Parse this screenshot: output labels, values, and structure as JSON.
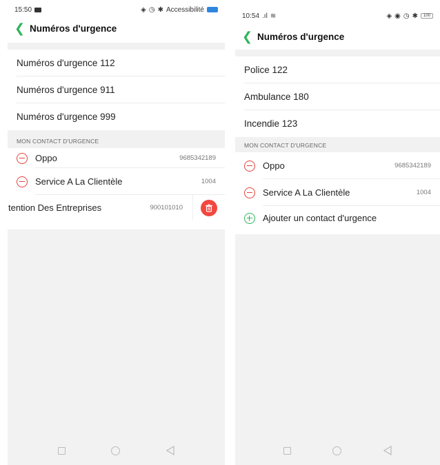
{
  "left": {
    "status": {
      "time": "15:50",
      "right_text": "Accessibilité"
    },
    "header": {
      "title": "Numéros d'urgence"
    },
    "numbers": [
      "Numéros d'urgence 112",
      "Numéros d'urgence 911",
      "Numéros d'urgence 999"
    ],
    "section_header": "MON CONTACT D'URGENCE",
    "contacts": [
      {
        "name": "Oppo",
        "number": "9685342189"
      },
      {
        "name": "Service A La Clientèle",
        "number": "1004"
      }
    ],
    "swiped_contact": {
      "name": "tention Des Entreprises",
      "number": "900101010"
    }
  },
  "right": {
    "status": {
      "time": "10:54",
      "battery": "100"
    },
    "header": {
      "title": "Numéros d'urgence"
    },
    "numbers": [
      "Police 122",
      "Ambulance 180",
      "Incendie 123"
    ],
    "section_header": "MON CONTACT D'URGENCE",
    "contacts": [
      {
        "name": "Oppo",
        "number": "9685342189"
      },
      {
        "name": "Service A La Clientèle",
        "number": "1004"
      }
    ],
    "add_contact_label": "Ajouter un contact d'urgence"
  },
  "colors": {
    "accent_green": "#2fb45a",
    "delete_red": "#e2433b",
    "background_gray": "#f2f2f2"
  },
  "icons": {
    "back": "chevron-left-icon",
    "remove": "minus-circle-icon",
    "add": "plus-circle-icon",
    "delete": "trash-icon",
    "nav_recent": "square-icon",
    "nav_home": "circle-icon",
    "nav_back": "triangle-left-icon"
  }
}
